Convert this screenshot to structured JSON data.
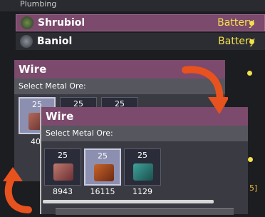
{
  "background": {
    "header_label": "Plumbing",
    "rows": [
      {
        "name": "Shrubiol",
        "tag": "Battery"
      },
      {
        "name": "Baniol",
        "tag": "Battery"
      }
    ],
    "side_text": "5]"
  },
  "panel_back": {
    "title": "Wire",
    "subtitle": "Select Metal Ore:",
    "slots": [
      {
        "qty": "25",
        "count": "40"
      },
      {
        "qty": "25"
      },
      {
        "qty": "25"
      }
    ]
  },
  "panel_front": {
    "title": "Wire",
    "subtitle": "Select Metal Ore:",
    "slots": [
      {
        "qty": "25",
        "count": "8943"
      },
      {
        "qty": "25",
        "count": "16115"
      },
      {
        "qty": "25",
        "count": "1129"
      }
    ]
  },
  "colors": {
    "accent": "#7b4a6c",
    "battery_text": "#f3e14a",
    "arrow": "#e7521e"
  }
}
